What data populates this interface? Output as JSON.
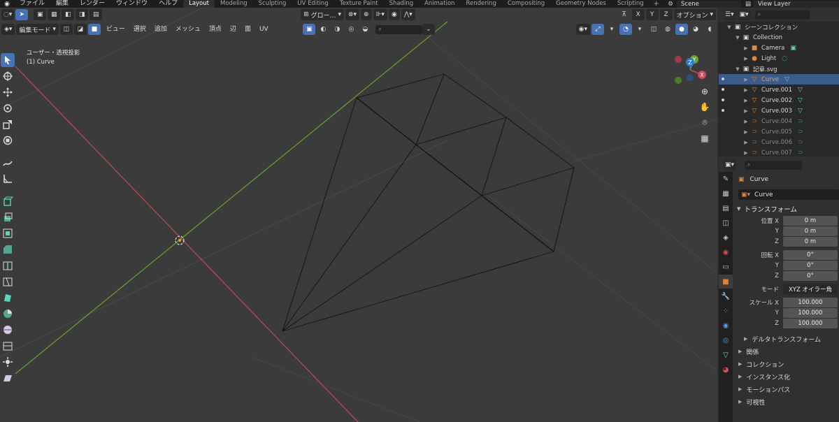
{
  "topbar": {
    "menus": [
      "ファイル",
      "編集",
      "レンダー",
      "ウィンドウ",
      "ヘルプ"
    ],
    "workspaces": [
      "Layout",
      "Modeling",
      "Sculpting",
      "UV Editing",
      "Texture Paint",
      "Shading",
      "Animation",
      "Rendering",
      "Compositing",
      "Geometry Nodes",
      "Scripting"
    ],
    "active_workspace": "Layout",
    "add_workspace": "+",
    "scene": "Scene",
    "view_layer": "View Layer"
  },
  "viewport": {
    "header1": {
      "orientation": "グロー…",
      "axes": [
        "X",
        "Y",
        "Z"
      ],
      "options": "オプション"
    },
    "header2": {
      "mode": "編集モード",
      "menus": [
        "ビュー",
        "選択",
        "追加",
        "メッシュ",
        "頂点",
        "辺",
        "面",
        "UV"
      ]
    },
    "info_view": "ユーザー・透視投影",
    "info_object": "(1) Curve",
    "gizmo_axes": {
      "x": "X",
      "y": "Y",
      "z": "Z"
    },
    "colors": {
      "x_axis": "#c24a58",
      "y_axis": "#6aa130",
      "z_axis": "#2f7bd8",
      "bg": "#3b3b3b"
    }
  },
  "outliner": {
    "rows": [
      {
        "label": "シーンコレクション",
        "indent": 0,
        "icon": "scene-collection-icon",
        "selected": false,
        "dim": false
      },
      {
        "label": "Collection",
        "indent": 1,
        "icon": "collection-icon",
        "selected": false,
        "dim": false
      },
      {
        "label": "Camera",
        "indent": 2,
        "icon": "camera-icon",
        "selected": false,
        "dim": false
      },
      {
        "label": "Light",
        "indent": 2,
        "icon": "light-icon",
        "selected": false,
        "dim": false
      },
      {
        "label": "記章.svg",
        "indent": 1,
        "icon": "collection-icon",
        "selected": false,
        "dim": false
      },
      {
        "label": "Curve",
        "indent": 2,
        "icon": "mesh-icon",
        "selected": true,
        "dim": false
      },
      {
        "label": "Curve.001",
        "indent": 2,
        "icon": "mesh-icon",
        "selected": false,
        "dim": false
      },
      {
        "label": "Curve.002",
        "indent": 2,
        "icon": "mesh-icon",
        "selected": false,
        "dim": false
      },
      {
        "label": "Curve.003",
        "indent": 2,
        "icon": "mesh-icon",
        "selected": false,
        "dim": false
      },
      {
        "label": "Curve.004",
        "indent": 2,
        "icon": "curve-icon",
        "selected": false,
        "dim": true
      },
      {
        "label": "Curve.005",
        "indent": 2,
        "icon": "curve-icon",
        "selected": false,
        "dim": true
      },
      {
        "label": "Curve.006",
        "indent": 2,
        "icon": "curve-icon",
        "selected": false,
        "dim": true
      },
      {
        "label": "Curve.007",
        "indent": 2,
        "icon": "curve-icon",
        "selected": false,
        "dim": true
      }
    ]
  },
  "properties": {
    "context_object": "Curve",
    "object_name": "Curve",
    "transform_title": "トランスフォーム",
    "location": {
      "label": "位置 X",
      "x": "0 m",
      "y": "0 m",
      "z": "0 m"
    },
    "rotation": {
      "label": "回転 X",
      "x": "0°",
      "y": "0°",
      "z": "0°"
    },
    "mode": {
      "label": "モード",
      "value": "XYZ オイラー角"
    },
    "scale": {
      "label": "スケール X",
      "x": "100.000",
      "y": "100.000",
      "z": "100.000"
    },
    "axis_y": "Y",
    "axis_z": "Z",
    "subsections": [
      "デルタトランスフォーム",
      "関係",
      "コレクション",
      "インスタンス化",
      "モーションパス",
      "可視性"
    ]
  }
}
